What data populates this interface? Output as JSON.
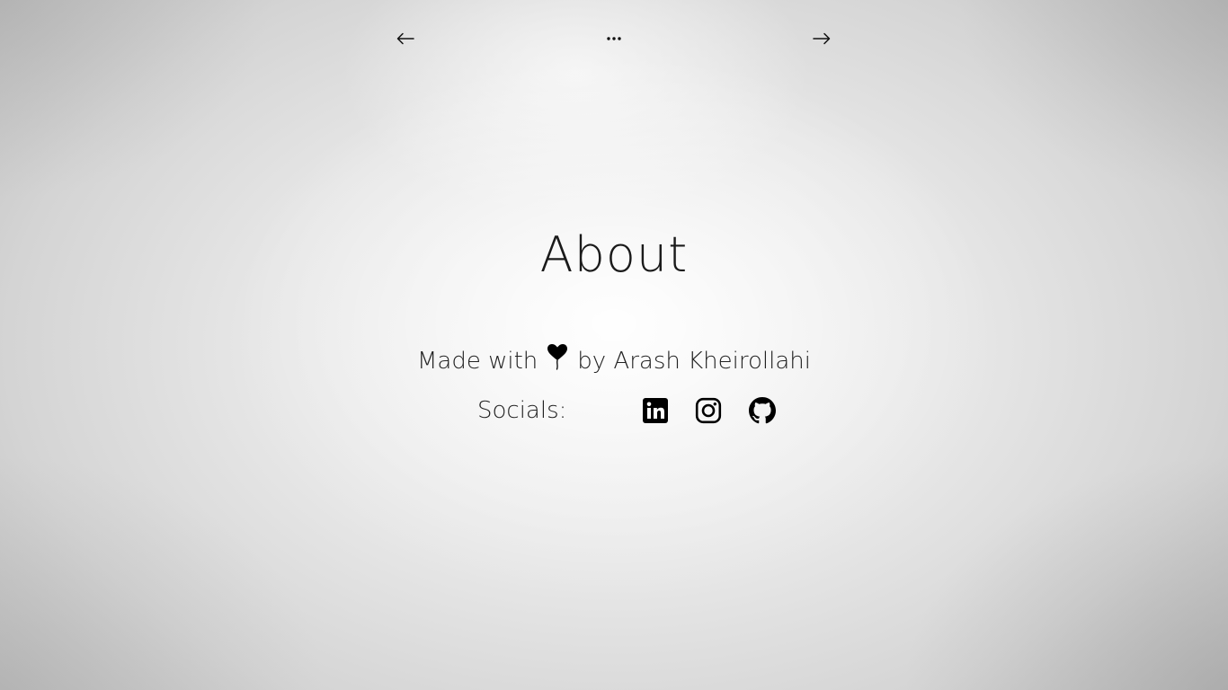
{
  "nav": {
    "prev_icon": "arrow-left-icon",
    "menu_icon": "more-horizontal-icon",
    "next_icon": "arrow-right-icon"
  },
  "page": {
    "title": "About",
    "credit_prefix": "Made with",
    "credit_icon": "heart-balloon-icon",
    "credit_suffix": "by Arash Kheirollahi"
  },
  "socials": {
    "label": "Socials:",
    "items": [
      {
        "name": "linkedin",
        "icon": "linkedin-icon"
      },
      {
        "name": "instagram",
        "icon": "instagram-icon"
      },
      {
        "name": "github",
        "icon": "github-icon"
      }
    ]
  },
  "colors": {
    "text": "#1a1a1a",
    "icon": "#000000",
    "background_center": "#ffffff",
    "background_edge": "#bdbdbd"
  }
}
